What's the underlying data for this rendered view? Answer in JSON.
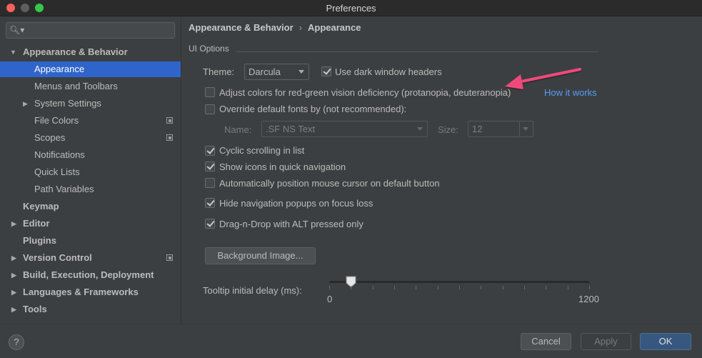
{
  "window": {
    "title": "Preferences"
  },
  "search": {
    "placeholder": ""
  },
  "sidebar": {
    "items": [
      {
        "label": "Appearance & Behavior"
      },
      {
        "label": "Appearance"
      },
      {
        "label": "Menus and Toolbars"
      },
      {
        "label": "System Settings"
      },
      {
        "label": "File Colors"
      },
      {
        "label": "Scopes"
      },
      {
        "label": "Notifications"
      },
      {
        "label": "Quick Lists"
      },
      {
        "label": "Path Variables"
      },
      {
        "label": "Keymap"
      },
      {
        "label": "Editor"
      },
      {
        "label": "Plugins"
      },
      {
        "label": "Version Control"
      },
      {
        "label": "Build, Execution, Deployment"
      },
      {
        "label": "Languages & Frameworks"
      },
      {
        "label": "Tools"
      }
    ]
  },
  "breadcrumb": {
    "parent": "Appearance & Behavior",
    "separator": "›",
    "current": "Appearance"
  },
  "ui_options": {
    "group_title": "UI Options",
    "theme_label": "Theme:",
    "theme_value": "Darcula",
    "dark_headers_label": "Use dark window headers",
    "dark_headers_checked": true,
    "color_adjust_label": "Adjust colors for red-green vision deficiency (protanopia, deuteranopia)",
    "color_adjust_checked": false,
    "how_it_works": "How it works",
    "override_fonts_label": "Override default fonts by (not recommended):",
    "override_fonts_checked": false,
    "font_name_label": "Name:",
    "font_name_value": ".SF NS Text",
    "font_size_label": "Size:",
    "font_size_value": "12",
    "cyclic_label": "Cyclic scrolling in list",
    "cyclic_checked": true,
    "show_icons_label": "Show icons in quick navigation",
    "show_icons_checked": true,
    "auto_cursor_label": "Automatically position mouse cursor on default button",
    "auto_cursor_checked": false,
    "hide_popups_label": "Hide navigation popups on focus loss",
    "hide_popups_checked": true,
    "dnd_label": "Drag-n-Drop with ALT pressed only",
    "dnd_checked": true,
    "background_image_button": "Background Image...",
    "tooltip_label": "Tooltip initial delay (ms):",
    "tooltip_min": "0",
    "tooltip_max": "1200",
    "tooltip_value_fraction": 0.083
  },
  "footer": {
    "help": "?",
    "cancel": "Cancel",
    "apply": "Apply",
    "ok": "OK"
  },
  "colors": {
    "selection": "#2f65ca",
    "link": "#589df6",
    "annotation_arrow": "#ef4a7c",
    "ok_button": "#365880"
  }
}
